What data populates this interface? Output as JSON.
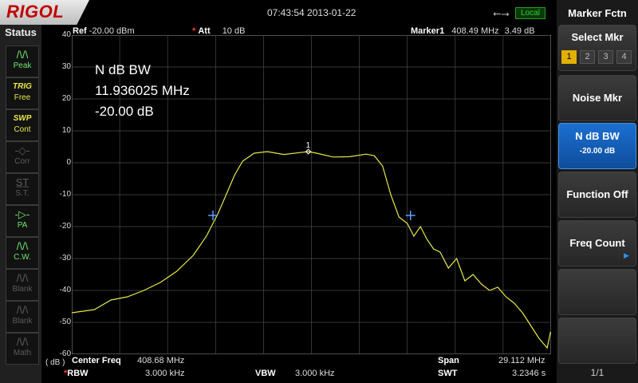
{
  "brand": "RIGOL",
  "datetime": "07:43:54 2013-01-22",
  "local_badge": "Local",
  "status_panel": {
    "title": "Status",
    "items": [
      {
        "icon": "/\\/\\",
        "label": "Peak",
        "state": "on"
      },
      {
        "icon": "TRIG",
        "label": "Free",
        "state": "trig"
      },
      {
        "icon": "SWP",
        "label": "Cont",
        "state": "trig"
      },
      {
        "icon": "-◇-",
        "label": "Corr",
        "state": "dim"
      },
      {
        "icon": "S̲T̲",
        "label": "S.T.",
        "state": "dim"
      },
      {
        "icon": "-▷-",
        "label": "PA",
        "state": "on"
      },
      {
        "icon": "/\\/\\",
        "label": "C.W.",
        "state": "on"
      },
      {
        "icon": "/\\/\\",
        "label": "Blank",
        "state": "dim"
      },
      {
        "icon": "/\\/\\",
        "label": "Blank",
        "state": "dim"
      },
      {
        "icon": "/\\/\\",
        "label": "Math",
        "state": "dim"
      }
    ]
  },
  "header": {
    "ref_label": "Ref",
    "ref_value": "-20.00 dBm",
    "att_star": "*",
    "att_label": "Att",
    "att_value": "10 dB",
    "marker_label": "Marker1",
    "marker_freq": "408.49 MHz",
    "marker_amp": "3.49 dB"
  },
  "annotation": {
    "line1": "N dB BW",
    "line2": "11.936025 MHz",
    "line3": "-20.00 dB"
  },
  "marker_tag": "1",
  "y_unit": "( dB )",
  "bottom": {
    "center_label": "Center Freq",
    "center_value": "408.68 MHz",
    "span_label": "Span",
    "span_value": "29.112 MHz",
    "rbw_star": "*",
    "rbw_label": "RBW",
    "rbw_value": "3.000 kHz",
    "vbw_label": "VBW",
    "vbw_value": "3.000 kHz",
    "swt_label": "SWT",
    "swt_value": "3.2346 s"
  },
  "menu": {
    "title": "Marker Fctn",
    "keys": [
      {
        "label": "Select Mkr"
      },
      {
        "label": "Noise Mkr"
      },
      {
        "label": "N dB BW",
        "sub": "-20.00 dB"
      },
      {
        "label": "Function Off"
      },
      {
        "label": "Freq Count"
      },
      {
        "label": ""
      },
      {
        "label": ""
      }
    ],
    "marker_numbers": [
      "1",
      "2",
      "3",
      "4"
    ],
    "selected_marker": "1",
    "page_indicator": "1/1"
  },
  "colors": {
    "trace": "#e8e84a",
    "active_key": "#1c6fd1",
    "grid": "#4a4a4a",
    "ndb_markers": "#5aa0ff"
  },
  "chart_data": {
    "type": "line",
    "ylim": [
      -60,
      40
    ],
    "yticks": [
      "40",
      "30",
      "20",
      "10",
      "0",
      "-10",
      "-20",
      "-30",
      "-40",
      "-50",
      "-60"
    ],
    "x_center_mhz": 408.68,
    "span_mhz": 29.112,
    "xlim_mhz": [
      394.124,
      423.236
    ],
    "series": [
      {
        "x_mhz": [
          394.12,
          395.5,
          396.5,
          397.5,
          398.5,
          399.5,
          400.5,
          401.5,
          402.3,
          403.0,
          403.5,
          404.0,
          404.5,
          405.2,
          406.0,
          407.0,
          408.0,
          408.49,
          409.0,
          410.0,
          411.0,
          412.0,
          412.5,
          413.0,
          413.5,
          414.0,
          414.5,
          414.9,
          415.3,
          415.7,
          416.1,
          416.5,
          417.0,
          417.5,
          418.0,
          418.5,
          419.0,
          419.5,
          420.0,
          420.5,
          421.0,
          421.5,
          422.0,
          422.5,
          423.0,
          423.2
        ],
        "y_db": [
          -47,
          -46,
          -43,
          -42,
          -40,
          -37.5,
          -34,
          -29,
          -23,
          -16,
          -10,
          -4,
          0.5,
          3,
          3.5,
          2.6,
          3.2,
          3.49,
          3,
          1.8,
          1.9,
          2.7,
          2.2,
          -1,
          -10,
          -17,
          -19,
          -23,
          -20,
          -24,
          -27,
          -28,
          -33,
          -30,
          -37,
          -35,
          -38,
          -40,
          -39,
          -42,
          -44,
          -47,
          -51,
          -55,
          -58,
          -53
        ]
      }
    ],
    "ndb_points": [
      {
        "x_mhz": 402.7,
        "y_db": -16.5
      },
      {
        "x_mhz": 414.7,
        "y_db": -16.5
      }
    ],
    "marker": {
      "label": "1",
      "x_mhz": 408.49,
      "y_db": 3.49
    },
    "grid": true
  }
}
